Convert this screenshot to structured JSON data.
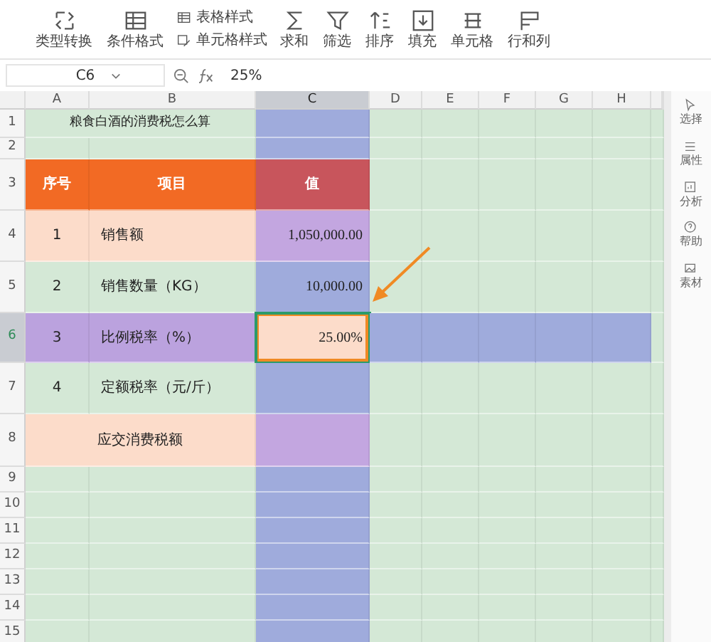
{
  "toolbar": {
    "items": [
      {
        "kind": "big",
        "label": "类型转换"
      },
      {
        "kind": "big",
        "label": "条件格式"
      },
      {
        "kind": "pair",
        "top": {
          "label": "表格样式"
        },
        "bottom": {
          "label": "单元格样式"
        }
      },
      {
        "kind": "big",
        "label": "求和"
      },
      {
        "kind": "big",
        "label": "筛选"
      },
      {
        "kind": "big",
        "label": "排序"
      },
      {
        "kind": "big",
        "label": "填充"
      },
      {
        "kind": "big",
        "label": "单元格"
      },
      {
        "kind": "big",
        "label": "行和列"
      }
    ]
  },
  "formula_bar": {
    "name_box": "C6",
    "formula": "25%"
  },
  "columns": [
    {
      "label": "A",
      "selected": false
    },
    {
      "label": "B",
      "selected": false
    },
    {
      "label": "C",
      "selected": true
    },
    {
      "label": "D",
      "selected": false
    },
    {
      "label": "E",
      "selected": false
    },
    {
      "label": "F",
      "selected": false
    },
    {
      "label": "G",
      "selected": false
    },
    {
      "label": "H",
      "selected": false
    }
  ],
  "rows": [
    {
      "number": "1",
      "selected": false,
      "cells": [
        {
          "kind": "title",
          "text": "粮食白酒的消费税怎么算",
          "color": "#d4e8d6"
        },
        {
          "kind": "value",
          "color": "#9fabdc",
          "selected": false
        }
      ]
    },
    {
      "number": "2",
      "selected": false,
      "cells": [
        {
          "kind": "plain",
          "color": "#d4e8d6"
        },
        {
          "kind": "plain",
          "color": "#d4e8d6"
        },
        {
          "kind": "value",
          "color": "#9fabdc",
          "selected": false
        }
      ]
    },
    {
      "number": "3",
      "selected": false,
      "cells": [
        {
          "kind": "header",
          "text": "序号",
          "color": "#f26a24"
        },
        {
          "kind": "header",
          "text": "项目",
          "color": "#f26a24"
        },
        {
          "kind": "header",
          "text": "值",
          "color": "#c8555c"
        }
      ]
    },
    {
      "number": "4",
      "selected": false,
      "cells": [
        {
          "kind": "index",
          "text": "1",
          "color": "#fcdcca"
        },
        {
          "kind": "item",
          "text": "销售额",
          "color": "#fcdcca"
        },
        {
          "kind": "value",
          "text": "1,050,000.00",
          "color": "#c3a6e0",
          "selected": false
        }
      ]
    },
    {
      "number": "5",
      "selected": false,
      "cells": [
        {
          "kind": "index",
          "text": "2",
          "color": "#d4e8d6"
        },
        {
          "kind": "item",
          "text": "销售数量（KG）",
          "color": "#d4e8d6"
        },
        {
          "kind": "value",
          "text": "10,000.00",
          "color": "#9fabdc",
          "selected": false
        }
      ]
    },
    {
      "number": "6",
      "selected": true,
      "cells": [
        {
          "kind": "index",
          "text": "3",
          "color": "#bba2de"
        },
        {
          "kind": "item",
          "text": "比例税率（%）",
          "color": "#bba2de"
        },
        {
          "kind": "value",
          "text": "25.00%",
          "color": "#fcdcca",
          "selected": true
        }
      ]
    },
    {
      "number": "7",
      "selected": false,
      "cells": [
        {
          "kind": "index",
          "text": "4",
          "color": "#d4e8d6"
        },
        {
          "kind": "item",
          "text": "定额税率（元/斤）",
          "color": "#d4e8d6"
        },
        {
          "kind": "value",
          "color": "#9fabdc",
          "selected": false
        }
      ]
    },
    {
      "number": "8",
      "selected": false,
      "cells": [
        {
          "kind": "total",
          "text": "应交消费税额",
          "color": "#fcdcca"
        },
        {
          "kind": "value",
          "color": "#c3a6e0",
          "selected": false
        }
      ]
    },
    {
      "number": "9",
      "selected": false,
      "cells": [
        {
          "kind": "plain",
          "color": "#d4e8d6"
        },
        {
          "kind": "plain",
          "color": "#d4e8d6"
        },
        {
          "kind": "value",
          "color": "#9fabdc",
          "selected": false
        }
      ]
    },
    {
      "number": "10",
      "selected": false,
      "cells": [
        {
          "kind": "plain",
          "color": "#d4e8d6"
        },
        {
          "kind": "plain",
          "color": "#d4e8d6"
        },
        {
          "kind": "value",
          "color": "#9fabdc",
          "selected": false
        }
      ]
    },
    {
      "number": "11",
      "selected": false,
      "cells": [
        {
          "kind": "plain",
          "color": "#d4e8d6"
        },
        {
          "kind": "plain",
          "color": "#d4e8d6"
        },
        {
          "kind": "value",
          "color": "#9fabdc",
          "selected": false
        }
      ]
    },
    {
      "number": "12",
      "selected": false,
      "cells": [
        {
          "kind": "plain",
          "color": "#d4e8d6"
        },
        {
          "kind": "plain",
          "color": "#d4e8d6"
        },
        {
          "kind": "value",
          "color": "#9fabdc",
          "selected": false
        }
      ]
    },
    {
      "number": "13",
      "selected": false,
      "cells": [
        {
          "kind": "plain",
          "color": "#d4e8d6"
        },
        {
          "kind": "plain",
          "color": "#d4e8d6"
        },
        {
          "kind": "value",
          "color": "#9fabdc",
          "selected": false
        }
      ]
    },
    {
      "number": "14",
      "selected": false,
      "cells": [
        {
          "kind": "plain",
          "color": "#d4e8d6"
        },
        {
          "kind": "plain",
          "color": "#d4e8d6"
        },
        {
          "kind": "value",
          "color": "#9fabdc",
          "selected": false
        }
      ]
    },
    {
      "number": "15",
      "selected": false,
      "cells": [
        {
          "kind": "plain",
          "color": "#d4e8d6"
        },
        {
          "kind": "plain",
          "color": "#d4e8d6"
        },
        {
          "kind": "value",
          "color": "#9fabdc",
          "selected": false
        }
      ]
    }
  ],
  "side_panel": [
    {
      "label": "选择"
    },
    {
      "label": "属性"
    },
    {
      "label": "分析"
    },
    {
      "label": "帮助"
    },
    {
      "label": "素材"
    }
  ]
}
